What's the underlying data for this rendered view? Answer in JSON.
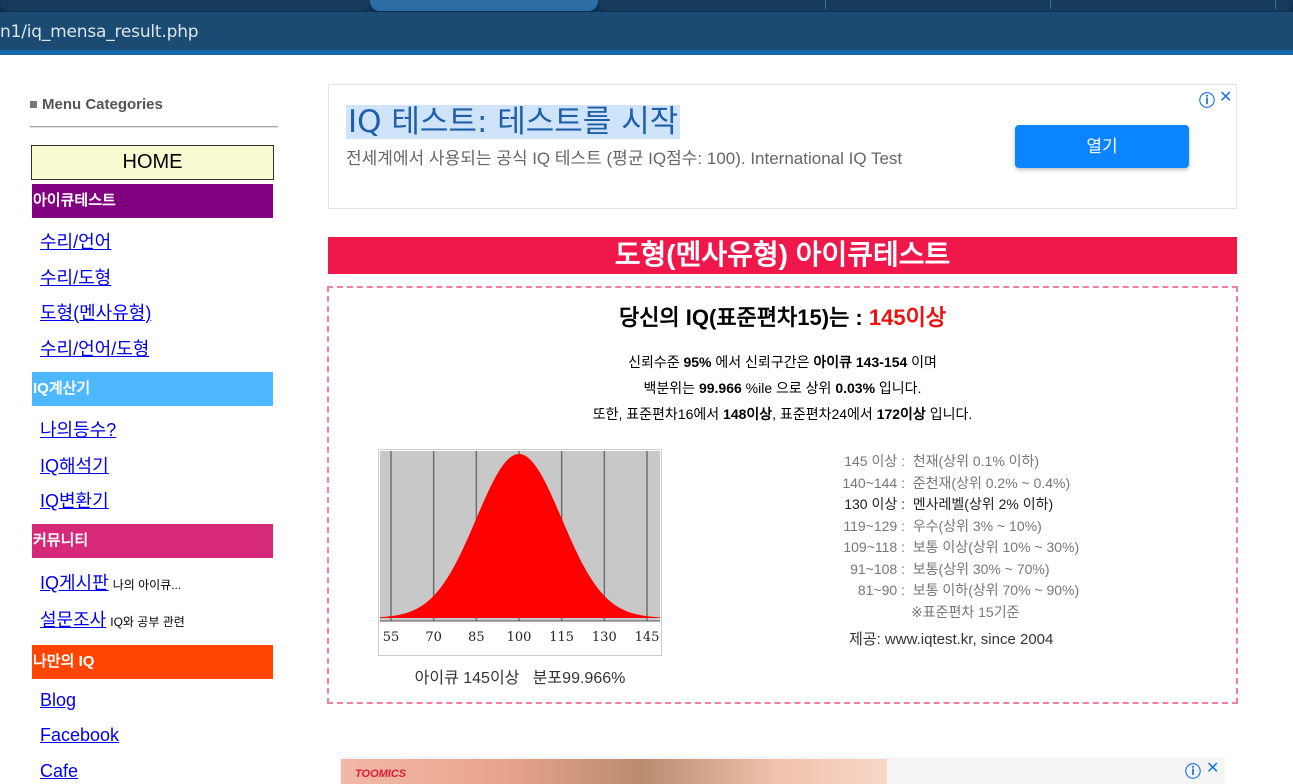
{
  "browser": {
    "url": "n1/iq_mensa_result.php"
  },
  "sidebar": {
    "heading": "Menu Categories",
    "home_label": "HOME",
    "categories": [
      {
        "title": "아이큐테스트",
        "color": "#800080",
        "links": [
          {
            "label": "수리/언어"
          },
          {
            "label": "수리/도형"
          },
          {
            "label": "도형(멘사유형)"
          },
          {
            "label": "수리/언어/도형"
          }
        ]
      },
      {
        "title": "IQ계산기",
        "color": "#4db8ff",
        "links": [
          {
            "label": "나의등수?"
          },
          {
            "label": "IQ해석기"
          },
          {
            "label": "IQ변환기"
          }
        ]
      },
      {
        "title": "커뮤니티",
        "color": "#d6297a",
        "links": [
          {
            "label": "IQ게시판",
            "note": "나의 아이큐..."
          },
          {
            "label": "설문조사",
            "note": "IQ와 공부 관련"
          }
        ]
      },
      {
        "title": "나만의 IQ",
        "color": "#ff4500",
        "links": [
          {
            "label": "Blog"
          },
          {
            "label": "Facebook"
          },
          {
            "label": "Cafe"
          }
        ]
      }
    ]
  },
  "ad": {
    "title": "IQ 테스트: 테스트를 시작",
    "description": "전세계에서 사용되는 공식 IQ 테스트 (평균 IQ점수: 100). International IQ Test",
    "button_label": "열기",
    "info_icon": "ⓘ",
    "close_icon": "✕"
  },
  "result": {
    "banner": "도형(멘사유형) 아이큐테스트",
    "headline_prefix": "당신의 IQ(표준편차15)는 : ",
    "headline_value": "145이상",
    "line1": {
      "a": "신뢰수준 ",
      "b": "95%",
      "c": " 에서 신뢰구간은 ",
      "d": "아이큐 143-154",
      "e": " 이며"
    },
    "line2": {
      "a": "백분위는 ",
      "b": "99.966",
      "c": " %ile 으로 상위 ",
      "d": "0.03%",
      "e": " 입니다."
    },
    "line3": {
      "a": "또한, 표준편차16에서 ",
      "b": "148이상",
      "c": ", 표준편차24에서 ",
      "d": "172이상",
      "e": " 입니다."
    },
    "chart_caption": "아이큐 145이상   분포99.966%",
    "chart_ticks": [
      "55",
      "70",
      "85",
      "100",
      "115",
      "130",
      "145"
    ],
    "legend": [
      {
        "range": "145 이상 :",
        "desc": "천재(상위 0.1% 이하)"
      },
      {
        "range": "140~144 :",
        "desc": "준천재(상위 0.2% ~ 0.4%)"
      },
      {
        "range": "130 이상 :",
        "desc": "멘사레벨(상위 2% 이하)"
      },
      {
        "range": "119~129 :",
        "desc": "우수(상위 3% ~ 10%)"
      },
      {
        "range": "109~118 :",
        "desc": "보통 이상(상위 10% ~ 30%)"
      },
      {
        "range": "91~108 :",
        "desc": "보통(상위 30% ~ 70%)"
      },
      {
        "range": "81~90 :",
        "desc": "보통 이하(상위 70% ~ 90%)"
      }
    ],
    "legend_note": "※표준편차 15기준",
    "credit": "제공: www.iqtest.kr, since 2004"
  },
  "bottom_ad": {
    "brand": "TOOMICS",
    "info_icon": "ⓘ",
    "close_icon": "✕"
  }
}
